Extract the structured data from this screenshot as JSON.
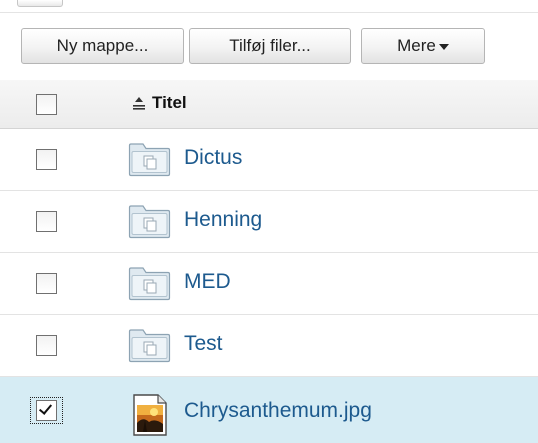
{
  "toolbar": {
    "new_folder_label": "Ny mappe...",
    "add_files_label": "Tilføj filer...",
    "more_label": "Mere"
  },
  "table": {
    "header_title": "Titel",
    "rows": [
      {
        "name": "Dictus",
        "type": "folder",
        "checked": false
      },
      {
        "name": "Henning",
        "type": "folder",
        "checked": false
      },
      {
        "name": "MED",
        "type": "folder",
        "checked": false
      },
      {
        "name": "Test",
        "type": "folder",
        "checked": false
      },
      {
        "name": "Chrysanthemum.jpg",
        "type": "image",
        "checked": true
      }
    ]
  },
  "colors": {
    "link": "#1d5a8e",
    "selected_row": "#d6ecf4"
  }
}
